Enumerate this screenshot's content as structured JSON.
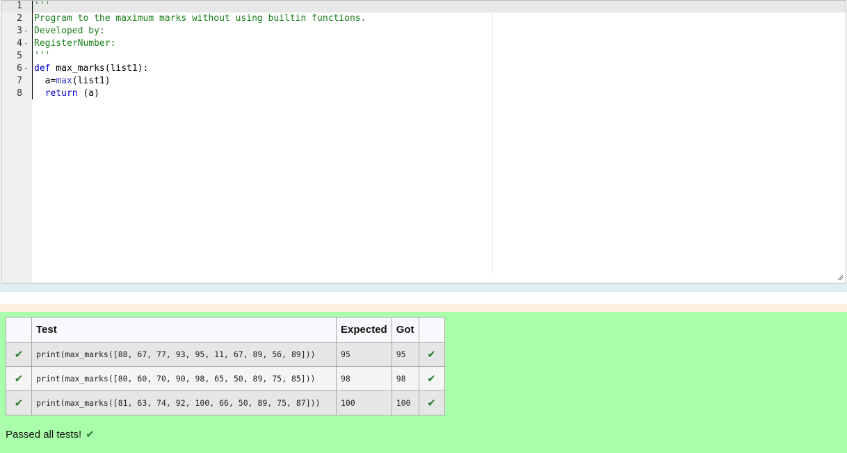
{
  "editor": {
    "lines": [
      {
        "num": "1",
        "fold": "",
        "segments": [
          {
            "t": "'''",
            "c": "str"
          }
        ]
      },
      {
        "num": "2",
        "fold": "",
        "segments": [
          {
            "t": "Program to the maximum marks without using builtin functions.",
            "c": "str"
          }
        ]
      },
      {
        "num": "3",
        "fold": "▾",
        "segments": [
          {
            "t": "Developed by:",
            "c": "str"
          }
        ]
      },
      {
        "num": "4",
        "fold": "▾",
        "segments": [
          {
            "t": "RegisterNumber:",
            "c": "str"
          }
        ]
      },
      {
        "num": "5",
        "fold": "",
        "segments": [
          {
            "t": "'''",
            "c": "str"
          }
        ]
      },
      {
        "num": "6",
        "fold": "▾",
        "segments": [
          {
            "t": "def",
            "c": "kw"
          },
          {
            "t": " max_marks(list1):",
            "c": ""
          }
        ]
      },
      {
        "num": "7",
        "fold": "",
        "segments": [
          {
            "t": "  a=",
            "c": ""
          },
          {
            "t": "max",
            "c": "bi"
          },
          {
            "t": "(list1)",
            "c": ""
          }
        ]
      },
      {
        "num": "8",
        "fold": "",
        "segments": [
          {
            "t": "  ",
            "c": ""
          },
          {
            "t": "return",
            "c": "kw"
          },
          {
            "t": " (a)",
            "c": ""
          }
        ]
      }
    ]
  },
  "results": {
    "headers": {
      "status": "",
      "test": "Test",
      "expected": "Expected",
      "got": "Got",
      "result": ""
    },
    "rows": [
      {
        "test": "print(max_marks([88, 67, 77, 93, 95, 11, 67, 89, 56, 89]))",
        "expected": "95",
        "got": "95"
      },
      {
        "test": "print(max_marks([80, 60, 70, 90, 98, 65, 50, 89, 75, 85]))",
        "expected": "98",
        "got": "98"
      },
      {
        "test": "print(max_marks([81, 63, 74, 92, 100, 66, 50, 89, 75, 87]))",
        "expected": "100",
        "got": "100"
      }
    ],
    "passed_text": "Passed all tests!",
    "icons": {
      "pass": "check-icon"
    },
    "colors": {
      "pass_background": "#aaffaa",
      "tick": "#2e7d32"
    }
  }
}
